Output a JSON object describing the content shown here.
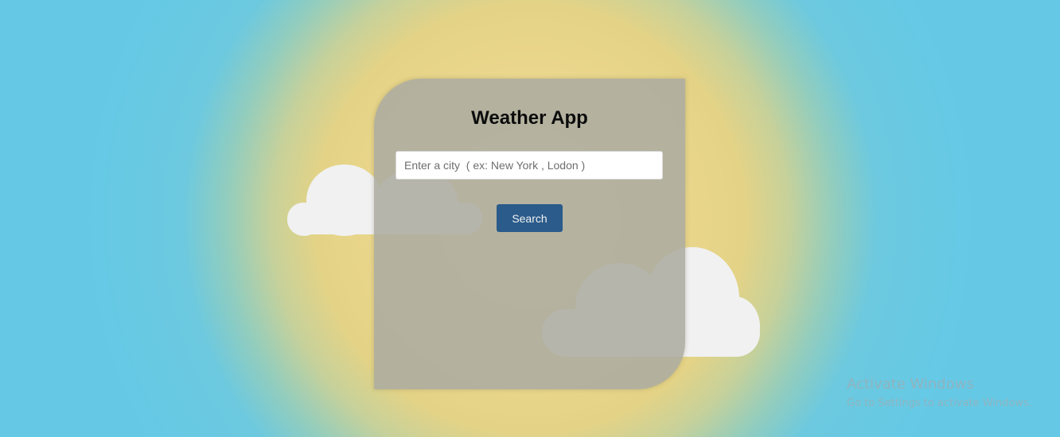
{
  "app": {
    "title": "Weather App"
  },
  "search": {
    "placeholder": "Enter a city  ( ex: New York , Lodon )",
    "value": "",
    "button_label": "Search"
  },
  "watermark": {
    "title": "Activate Windows",
    "subtitle": "Go to Settings to activate Windows."
  },
  "colors": {
    "button": "#2a5b8a",
    "card": "#acac9f",
    "sky": "#65c9e6",
    "sun": "#ebd78e",
    "cloud": "#f1f1f1"
  },
  "icons": {
    "cloud": "cloud-icon"
  }
}
